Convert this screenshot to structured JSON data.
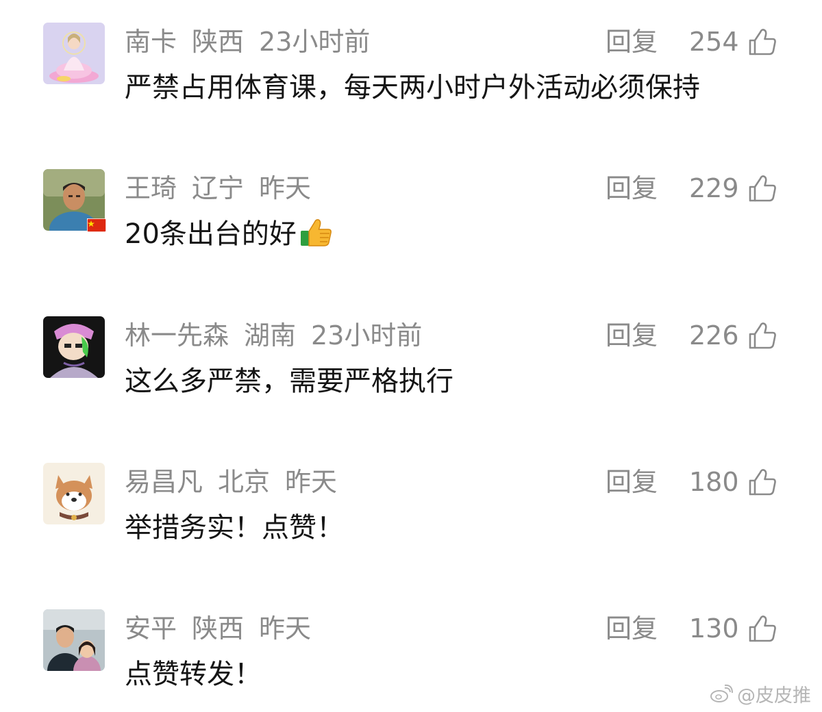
{
  "comments": [
    {
      "name": "南卡",
      "location": "陕西",
      "time": "23小时前",
      "text": "严禁占用体育课，每天两小时户外活动必须保持",
      "reply_label": "回复",
      "likes": "254",
      "avatar_icon": "goddess-avatar-icon"
    },
    {
      "name": "王琦",
      "location": "辽宁",
      "time": "昨天",
      "text": "20条出台的好",
      "emoji": "thumbs-up-emoji",
      "reply_label": "回复",
      "likes": "229",
      "avatar_icon": "man-photo-avatar-icon",
      "badge_icon": "china-flag-icon"
    },
    {
      "name": "林一先森",
      "location": "湖南",
      "time": "23小时前",
      "text": "这么多严禁，需要严格执行",
      "reply_label": "回复",
      "likes": "226",
      "avatar_icon": "cartoon-character-avatar-icon"
    },
    {
      "name": "易昌凡",
      "location": "北京",
      "time": "昨天",
      "text": "举措务实！点赞！",
      "reply_label": "回复",
      "likes": "180",
      "avatar_icon": "shiba-dog-avatar-icon"
    },
    {
      "name": "安平",
      "location": "陕西",
      "time": "昨天",
      "text": "点赞转发！",
      "reply_label": "回复",
      "likes": "130",
      "avatar_icon": "family-photo-avatar-icon"
    }
  ],
  "watermark": {
    "text": "@皮皮推",
    "icon": "weibo-logo-icon"
  },
  "colors": {
    "meta_text": "#8a8a8a",
    "body_text": "#151515",
    "background": "#ffffff"
  }
}
